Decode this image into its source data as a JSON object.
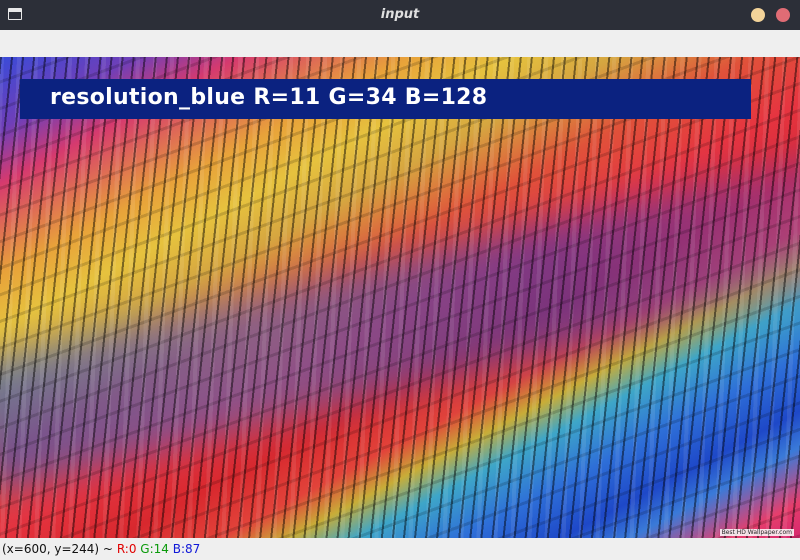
{
  "window": {
    "title": "input",
    "icon": "window-icon",
    "controls": {
      "minimize_color": "#f3d399",
      "close_color": "#e06c75"
    }
  },
  "image": {
    "label": "resolution_blue R=11 G=34 B=128",
    "label_background": "#0b2280",
    "watermark": "Best HD Wallpaper.com"
  },
  "status": {
    "coords": "(x=600, y=244) ~",
    "r": "R:0",
    "g": "G:14",
    "b": "B:87"
  }
}
